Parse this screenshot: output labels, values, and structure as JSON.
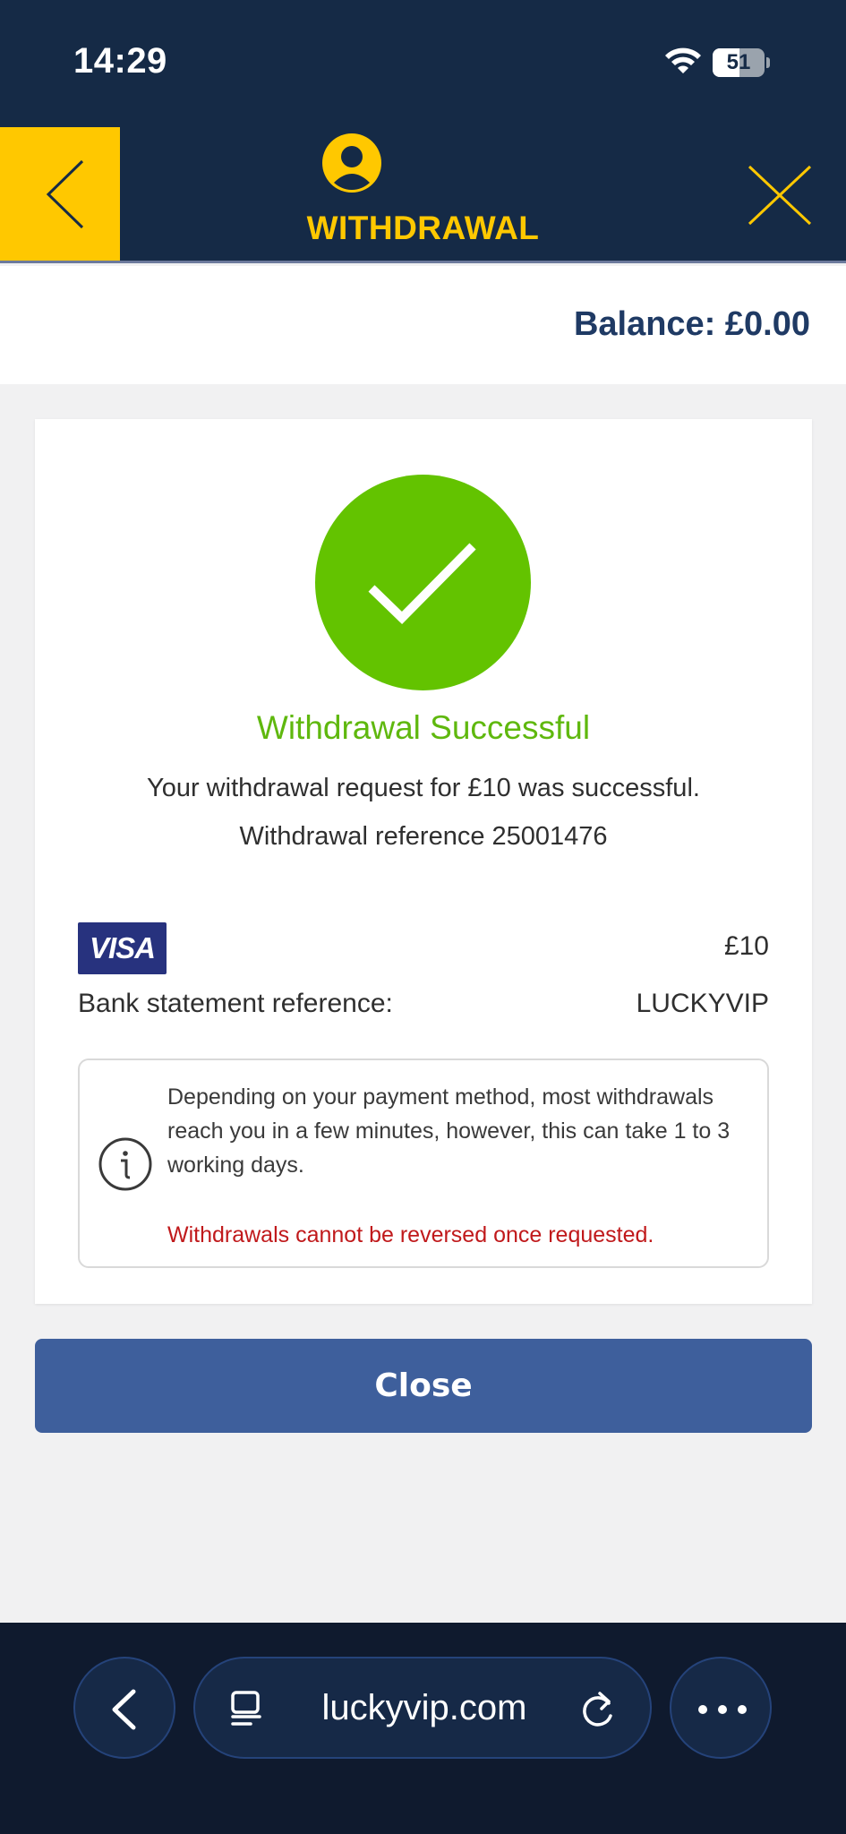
{
  "status_bar": {
    "time": "14:29",
    "battery_level": "51",
    "battery_fraction": 0.51,
    "icons": [
      "wifi-icon",
      "battery-icon"
    ]
  },
  "header": {
    "title": "WITHDRAWAL",
    "icons": [
      "chevron-left-icon",
      "user-icon",
      "close-icon"
    ],
    "accent_color": "#ffc800",
    "background_color": "#152a46"
  },
  "balance": {
    "text": "Balance: £0.00"
  },
  "result": {
    "title": "Withdrawal Successful",
    "message": "Your withdrawal request for £10 was successful.",
    "reference_line": "Withdrawal reference 25001476",
    "success_color": "#63c300"
  },
  "payment": {
    "card_brand": "VISA",
    "amount": "£10",
    "bank_statement_label": "Bank statement reference:",
    "bank_statement_value": "LUCKYVIP"
  },
  "info": {
    "icon": "info-icon",
    "text": "Depending on your payment method, most withdrawals reach you in a few minutes, however, this can take 1 to 3 working days.",
    "warning": "Withdrawals cannot be reversed once requested.",
    "warning_color": "#c0191b"
  },
  "actions": {
    "close_label": "Close",
    "button_color": "#3e5f9c"
  },
  "browser": {
    "url": "luckyvip.com",
    "icons": [
      "chevron-left-icon",
      "tabs-icon",
      "reload-icon",
      "more-icon"
    ]
  }
}
